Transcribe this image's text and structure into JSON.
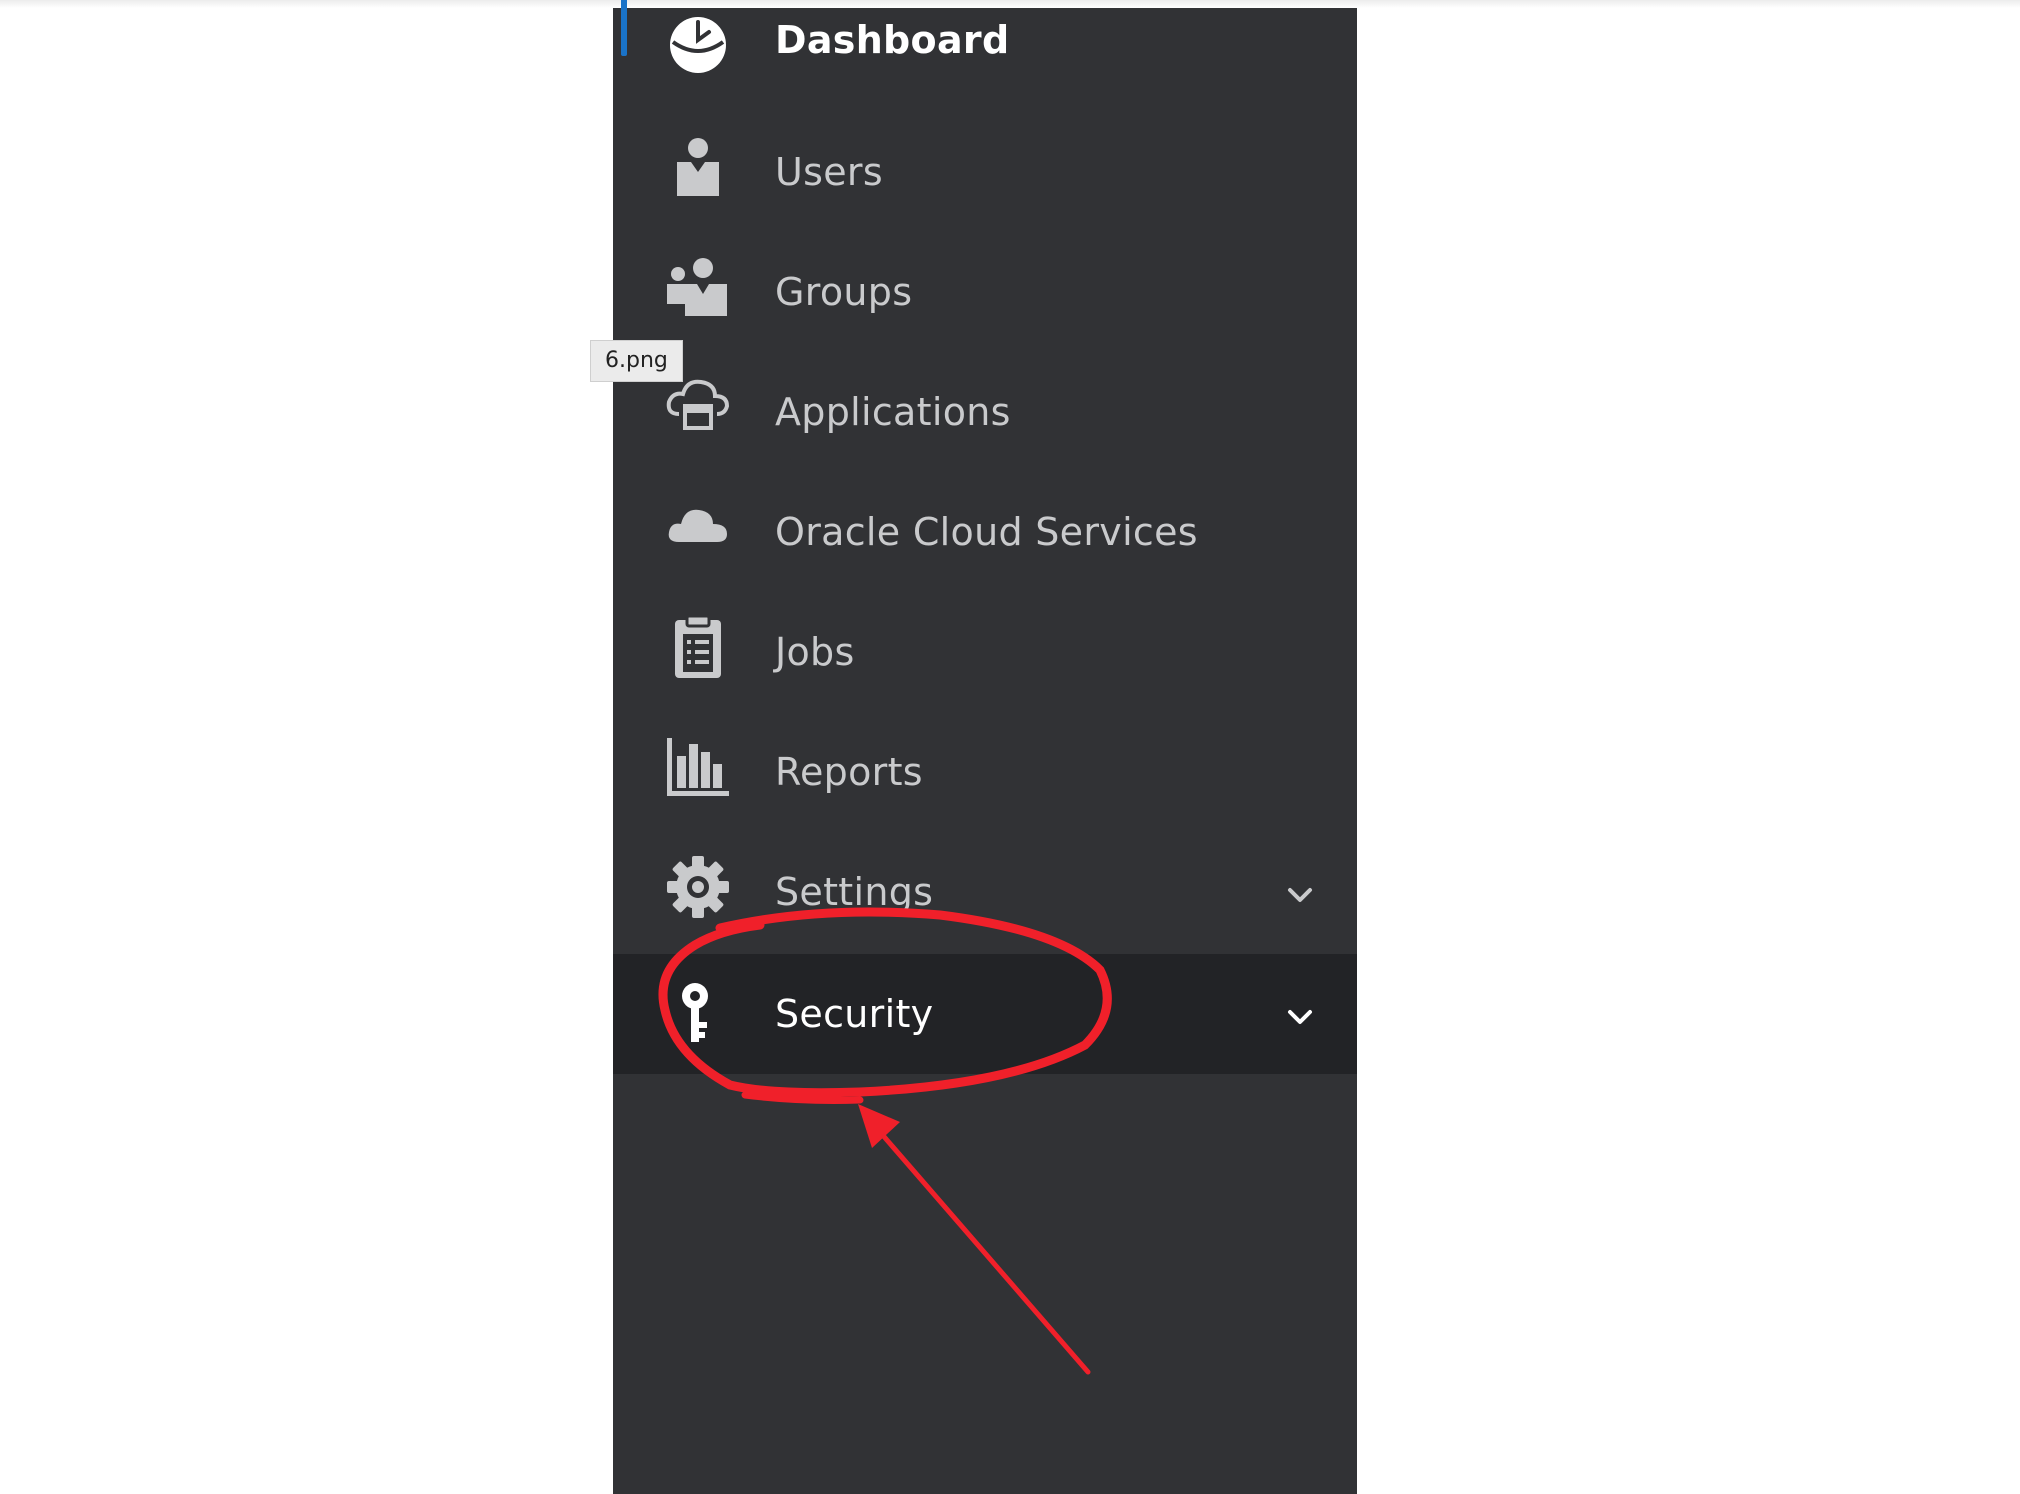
{
  "tooltip": {
    "text": "6.png"
  },
  "sidebar": {
    "items": [
      {
        "label": "Dashboard",
        "icon": "dashboard-icon"
      },
      {
        "label": "Users",
        "icon": "user-icon"
      },
      {
        "label": "Groups",
        "icon": "groups-icon"
      },
      {
        "label": "Applications",
        "icon": "cloud-app-icon"
      },
      {
        "label": "Oracle Cloud Services",
        "icon": "cloud-icon"
      },
      {
        "label": "Jobs",
        "icon": "clipboard-icon"
      },
      {
        "label": "Reports",
        "icon": "bar-chart-icon"
      },
      {
        "label": "Settings",
        "icon": "gear-icon",
        "expandable": true
      },
      {
        "label": "Security",
        "icon": "key-icon",
        "expandable": true,
        "selected": true
      }
    ]
  },
  "colors": {
    "sidebar_bg": "#313235",
    "selected_bg": "#222326",
    "active_indicator": "#1a73c8",
    "annotation": "#f0202a",
    "text_default": "#c9cacc",
    "text_active": "#ffffff"
  }
}
